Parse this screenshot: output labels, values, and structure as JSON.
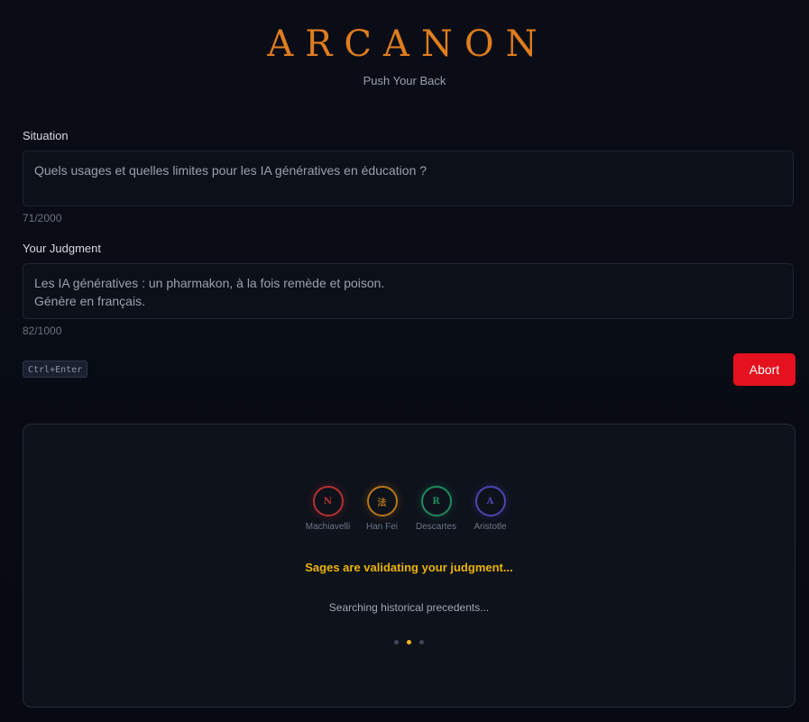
{
  "header": {
    "brand": "ARCANON",
    "tagline": "Push Your Back"
  },
  "situation": {
    "label": "Situation",
    "value": "Quels usages et quelles limites pour les IA génératives en éducation ?",
    "counter": "71/2000"
  },
  "judgment": {
    "label": "Your Judgment",
    "value_line1": "Les IA génératives : un pharmakon, à la fois remède et poison.",
    "value_line2": "Génère en français.",
    "counter": "82/1000"
  },
  "actions": {
    "shortcut": "Ctrl+Enter",
    "abort_label": "Abort"
  },
  "panel": {
    "sages": [
      {
        "initial": "N",
        "name": "Machiavelli",
        "color": "#b4312f"
      },
      {
        "initial": "法",
        "name": "Han Fei",
        "color": "#b8761a"
      },
      {
        "initial": "R",
        "name": "Descartes",
        "color": "#1f8a5e"
      },
      {
        "initial": "A",
        "name": "Aristotle",
        "color": "#4b45b3"
      }
    ],
    "status_title": "Sages are validating your judgment...",
    "status_sub": "Searching historical precedents...",
    "progress_dots": 3,
    "active_dot": 2
  },
  "colors": {
    "brand": "#df7d1f",
    "abort": "#e5111f",
    "status": "#eab308",
    "active_dot": "#f5b820"
  }
}
